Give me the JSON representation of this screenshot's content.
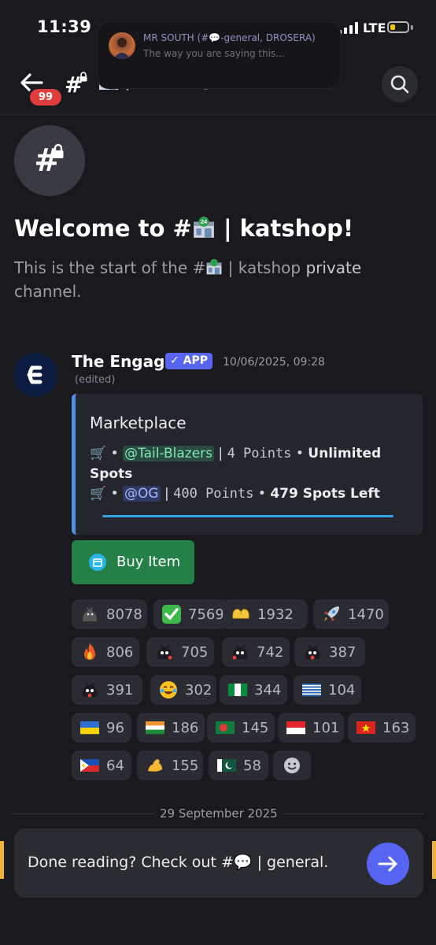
{
  "status": {
    "time": "11:39",
    "network": "LTE"
  },
  "notification": {
    "title": "MR SOUTH (#💬-general, DROSERA)",
    "body": "The way you are saying this..."
  },
  "header": {
    "badge": "99",
    "channel_title": "katshop",
    "separator": "|"
  },
  "welcome": {
    "title_prefix": "Welcome to #",
    "title_suffix": " | katshop!",
    "sub_prefix": "This is the start of the #",
    "sub_mid": " | katshop ",
    "sub_private": "private",
    "sub_end": "channel."
  },
  "message": {
    "author": "The Engage",
    "tag": "APP",
    "timestamp": "10/06/2025, 09:28",
    "edited": "(edited)",
    "embed": {
      "title": "Marketplace",
      "item1_role": "@Tail-Blazers",
      "item1_points": "4 Points",
      "item1_spots": "Unlimited Spots",
      "item1_spots_a": "Unlimited",
      "item1_spots_b": "Spots",
      "item2_role": "@OG",
      "item2_points": "400 Points",
      "item2_spots": "479 Spots Left",
      "bullet": "•",
      "bar": "|"
    },
    "button": "Buy Item"
  },
  "reactions": [
    {
      "emoji": "cat",
      "count": "8078"
    },
    {
      "emoji": "check",
      "count": "7569"
    },
    {
      "emoji": "heart-hands",
      "count": "1932"
    },
    {
      "emoji": "rocket",
      "count": "1470"
    },
    {
      "emoji": "fire",
      "count": "806"
    },
    {
      "emoji": "cat-sticker-1",
      "count": "705"
    },
    {
      "emoji": "cat-sticker-2",
      "count": "742"
    },
    {
      "emoji": "cat-sticker-3",
      "count": "387"
    },
    {
      "emoji": "cat-sticker-4",
      "count": "391"
    },
    {
      "emoji": "joy",
      "count": "302"
    },
    {
      "emoji": "flag-nigeria",
      "count": "344"
    },
    {
      "emoji": "flag-greece",
      "count": "104"
    },
    {
      "emoji": "flag-ukraine",
      "count": "96"
    },
    {
      "emoji": "flag-india",
      "count": "186"
    },
    {
      "emoji": "flag-bangladesh",
      "count": "145"
    },
    {
      "emoji": "flag-indonesia",
      "count": "101"
    },
    {
      "emoji": "flag-vietnam",
      "count": "163"
    },
    {
      "emoji": "flag-philippines",
      "count": "64"
    },
    {
      "emoji": "muscle",
      "count": "155"
    },
    {
      "emoji": "flag-pakistan",
      "count": "58"
    }
  ],
  "date_separator": "29 September 2025",
  "next_channel": {
    "prefix": "Done reading? Check out #",
    "suffix": " | general."
  },
  "colors": {
    "accent": "#5865f2",
    "button_green": "#248046",
    "badge_red": "#e03e3e",
    "embed_border": "#4f8fe6"
  }
}
